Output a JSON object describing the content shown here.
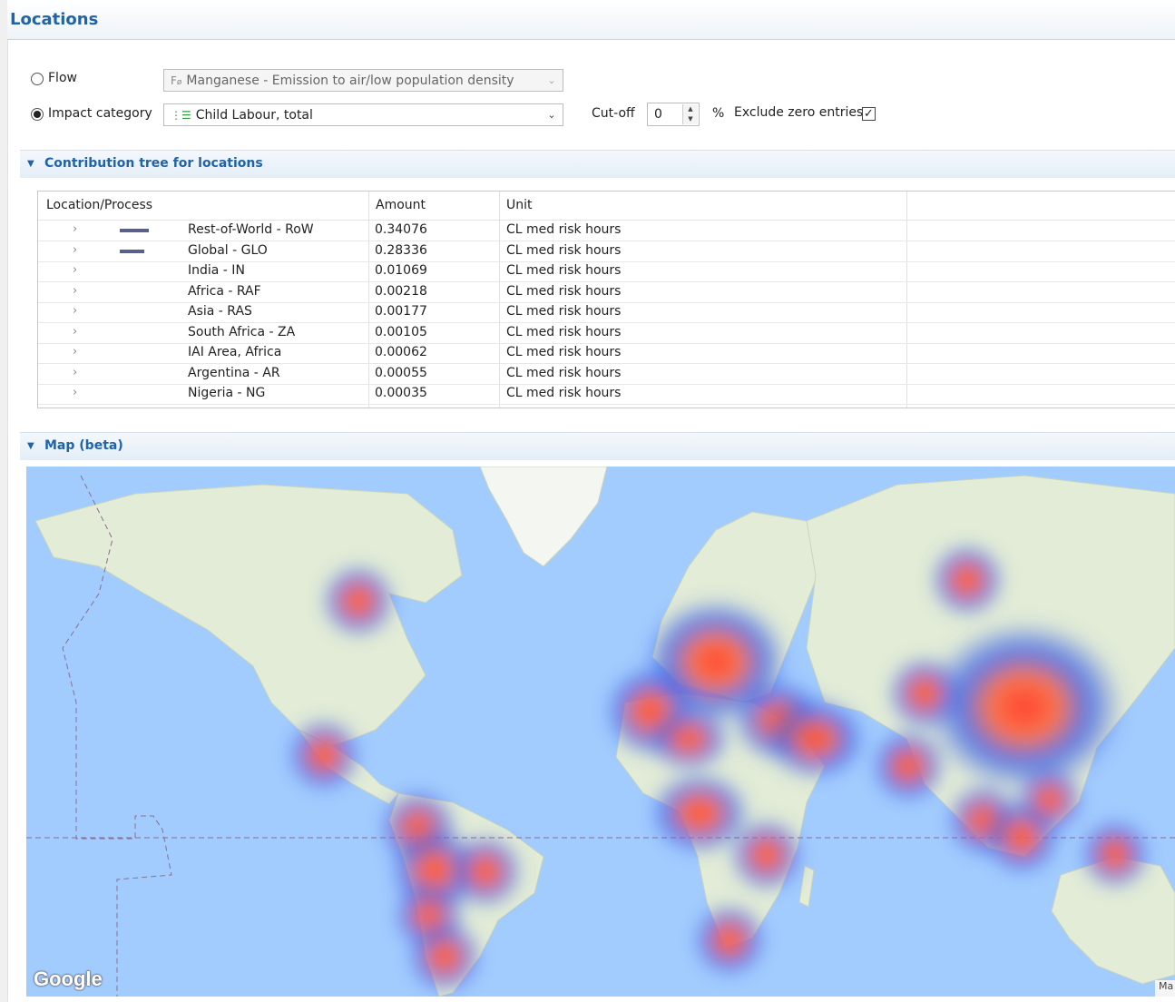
{
  "header": {
    "title": "Locations"
  },
  "selection": {
    "flow_label": "Flow",
    "flow_value": "Manganese - Emission to air/low population density",
    "impact_label": "Impact category",
    "impact_value": "Child Labour, total",
    "cutoff_label": "Cut-off",
    "cutoff_value": "0",
    "percent_label": "%",
    "exclude_label": "Exclude zero entries",
    "exclude_checked": true
  },
  "tree_section": {
    "title": "Contribution tree for locations",
    "columns": [
      "Location/Process",
      "Amount",
      "Unit"
    ],
    "rows": [
      {
        "location": "Rest-of-World - RoW",
        "amount": "0.34076",
        "unit": "CL med risk hours",
        "share": 1.0
      },
      {
        "location": "Global - GLO",
        "amount": "0.28336",
        "unit": "CL med risk hours",
        "share": 0.83
      },
      {
        "location": "India - IN",
        "amount": "0.01069",
        "unit": "CL med risk hours",
        "share": 0.03
      },
      {
        "location": "Africa - RAF",
        "amount": "0.00218",
        "unit": "CL med risk hours",
        "share": 0.006
      },
      {
        "location": "Asia - RAS",
        "amount": "0.00177",
        "unit": "CL med risk hours",
        "share": 0.005
      },
      {
        "location": "South Africa - ZA",
        "amount": "0.00105",
        "unit": "CL med risk hours",
        "share": 0.003
      },
      {
        "location": "IAI Area, Africa",
        "amount": "0.00062",
        "unit": "CL med risk hours",
        "share": 0.002
      },
      {
        "location": "Argentina - AR",
        "amount": "0.00055",
        "unit": "CL med risk hours",
        "share": 0.002
      },
      {
        "location": "Nigeria - NG",
        "amount": "0.00035",
        "unit": "CL med risk hours",
        "share": 0.001
      }
    ]
  },
  "map_section": {
    "title": "Map (beta)",
    "logo_text": "Google",
    "attribution_text": "Ma"
  },
  "colors": {
    "accent": "#1f64a8",
    "bar": "#5a5f8c",
    "ocean": "#a3ccfe",
    "land": "#e3ecd6",
    "heat_core": "#ff3b2f",
    "heat_halo": "#2f5ce0"
  },
  "icons": {
    "flow_icon": "flow-icon",
    "impact_icon": "impact-category-icon",
    "expand": "chevron-right-icon",
    "section_toggle": "triangle-down-icon"
  }
}
